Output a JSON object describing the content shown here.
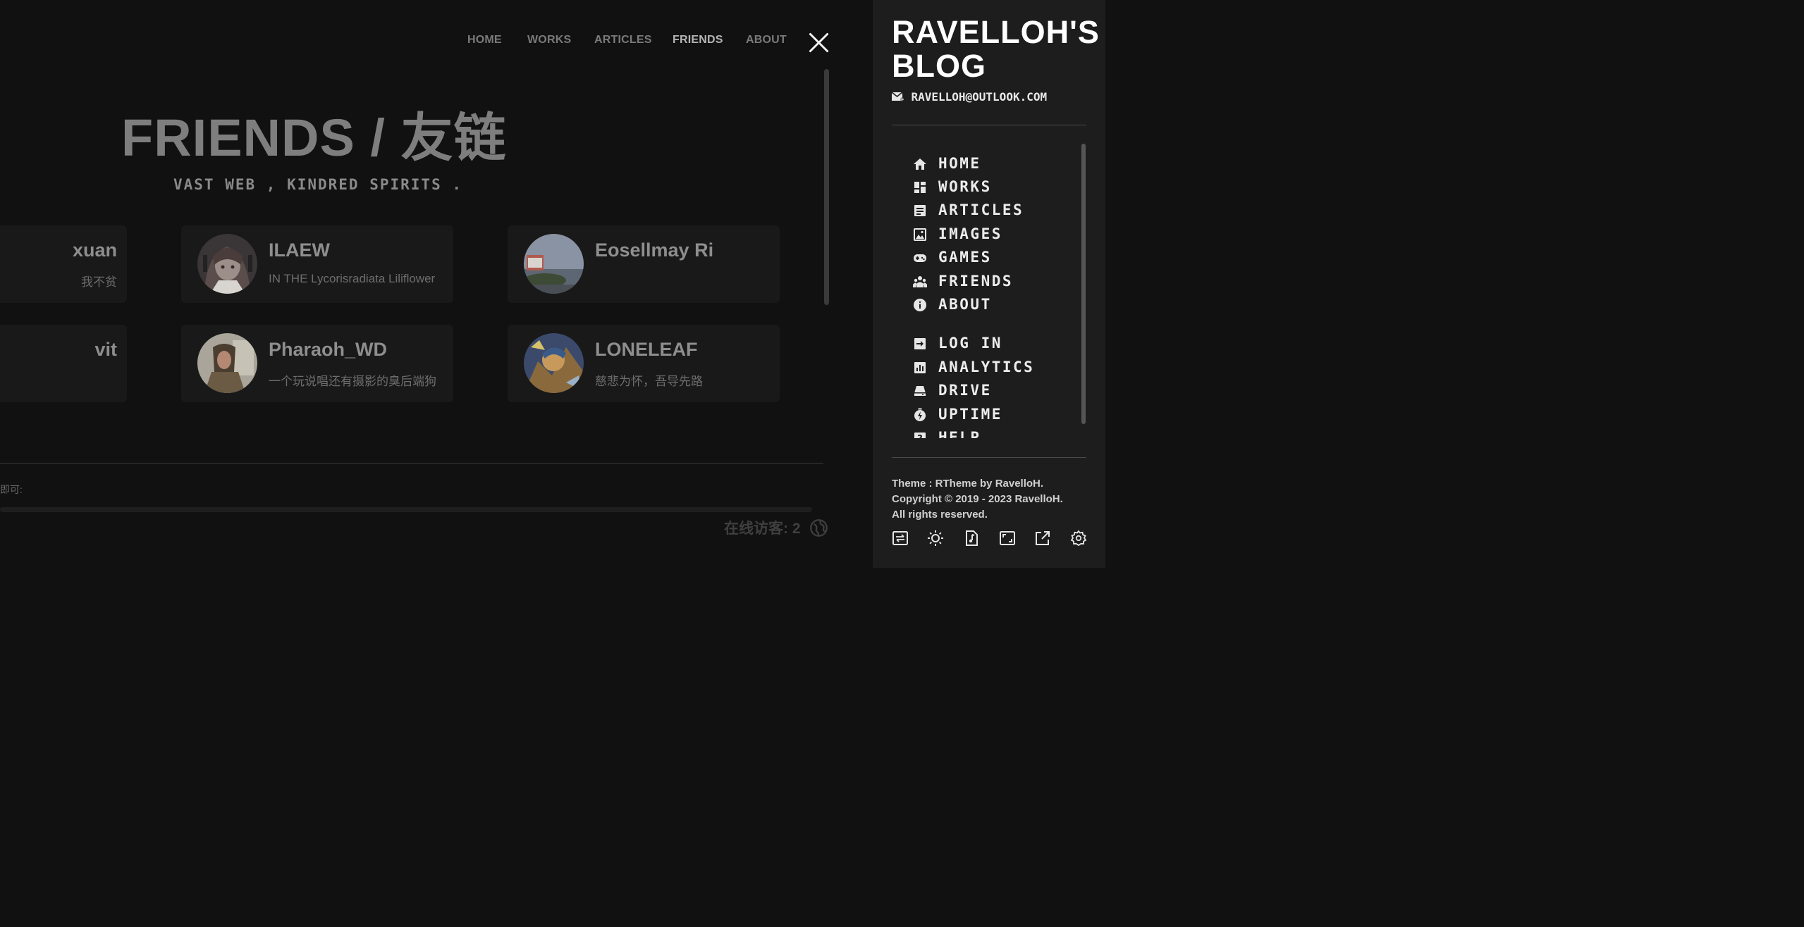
{
  "nav": {
    "items": [
      {
        "label": "HOME"
      },
      {
        "label": "WORKS"
      },
      {
        "label": "ARTICLES"
      },
      {
        "label": "FRIENDS",
        "active": true
      },
      {
        "label": "ABOUT"
      }
    ]
  },
  "page": {
    "title": "FRIENDS / 友链",
    "subtitle": "VAST WEB , KINDRED SPIRITS ."
  },
  "friends": [
    {
      "name": "xuan",
      "desc": "我不贫"
    },
    {
      "name": "ILAEW",
      "desc": "IN THE Lycorisradiata Liliflower"
    },
    {
      "name": "Eosellmay Ri",
      "desc": ""
    },
    {
      "name": "vit",
      "desc": ""
    },
    {
      "name": "Pharaoh_WD",
      "desc": "一个玩说唱还有摄影的臭后端狗"
    },
    {
      "name": "LONELEAF",
      "desc": "慈悲为怀，吾导先路"
    }
  ],
  "comments": {
    "hint": "即可:"
  },
  "online": {
    "text": "在线访客: 2"
  },
  "sidebar": {
    "blog_title": "RAVELLOH'S BLOG",
    "email": "RAVELLOH@OUTLOOK.COM",
    "menu": [
      {
        "label": "HOME",
        "icon": "home-icon"
      },
      {
        "label": "WORKS",
        "icon": "dashboard-icon"
      },
      {
        "label": "ARTICLES",
        "icon": "article-icon"
      },
      {
        "label": "IMAGES",
        "icon": "image-icon"
      },
      {
        "label": "GAMES",
        "icon": "gamepad-icon"
      },
      {
        "label": "FRIENDS",
        "icon": "people-icon"
      },
      {
        "label": "ABOUT",
        "icon": "info-icon"
      },
      {
        "label": "LOG IN",
        "icon": "login-icon"
      },
      {
        "label": "ANALYTICS",
        "icon": "analytics-icon"
      },
      {
        "label": "DRIVE",
        "icon": "drive-icon"
      },
      {
        "label": "UPTIME",
        "icon": "timer-icon"
      },
      {
        "label": "HELP",
        "icon": "help-icon"
      }
    ],
    "footer": {
      "theme": "Theme : RTheme by RavelloH.",
      "copyright": "Copyright © 2019 - 2023 RavelloH.",
      "rights": "All rights reserved."
    },
    "footer_icons": [
      "swap-icon",
      "sun-icon",
      "music-icon",
      "fullscreen-icon",
      "external-link-icon",
      "settings-icon"
    ]
  },
  "colors": {
    "background": "#111111",
    "sidebar": "#1d1d1d",
    "card": "#191919"
  }
}
